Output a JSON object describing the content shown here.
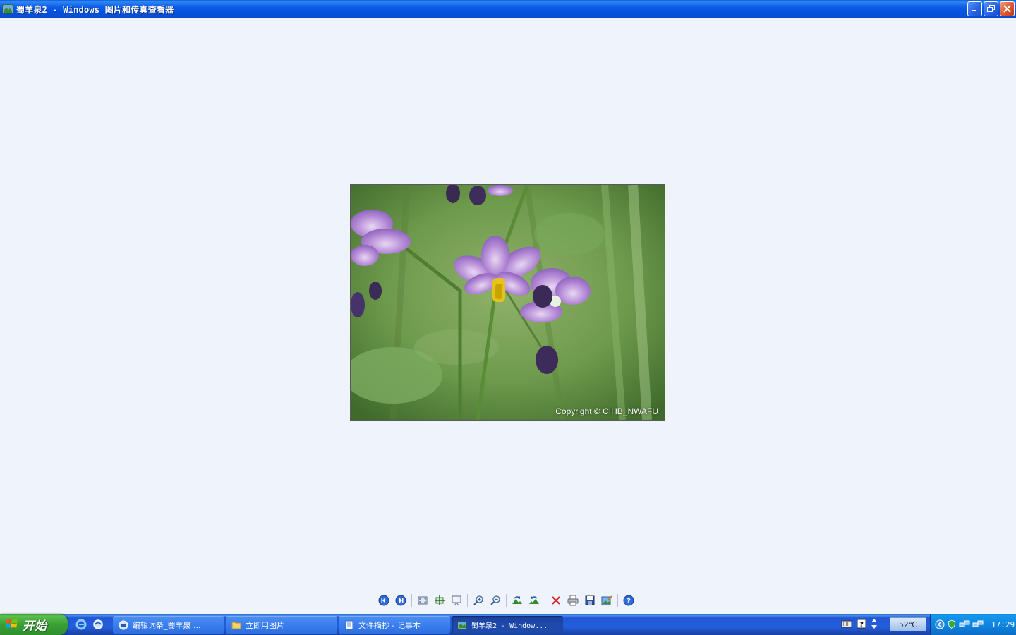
{
  "window": {
    "title": "蜀羊泉2 - Windows 图片和传真查看器",
    "controls": [
      "minimize",
      "restore",
      "close"
    ]
  },
  "image": {
    "description_icon": "photo",
    "watermark": "Copyright © CIHB_NWAFU"
  },
  "toolbar": {
    "buttons": [
      {
        "name": "previous-image-button",
        "icon": "previous-icon"
      },
      {
        "name": "next-image-button",
        "icon": "next-icon"
      },
      {
        "name": "best-fit-button",
        "icon": "best-fit-icon"
      },
      {
        "name": "actual-size-button",
        "icon": "actual-size-icon"
      },
      {
        "name": "slideshow-button",
        "icon": "slideshow-icon"
      },
      {
        "name": "zoom-in-button",
        "icon": "zoom-in-icon"
      },
      {
        "name": "zoom-out-button",
        "icon": "zoom-out-icon"
      },
      {
        "name": "rotate-clockwise-button",
        "icon": "rotate-clockwise-icon"
      },
      {
        "name": "rotate-counterclockwise-button",
        "icon": "rotate-counterclockwise-icon"
      },
      {
        "name": "delete-button",
        "icon": "delete-icon"
      },
      {
        "name": "print-button",
        "icon": "print-icon"
      },
      {
        "name": "save-button",
        "icon": "save-icon"
      },
      {
        "name": "edit-button",
        "icon": "edit-icon"
      },
      {
        "name": "help-button",
        "icon": "help-icon"
      }
    ]
  },
  "taskbar": {
    "start_label": "开始",
    "tasks": [
      {
        "label": "编辑词条_蜀羊泉 ...",
        "icon": "browser-page-icon"
      },
      {
        "label": "立即用图片",
        "icon": "folder-icon"
      },
      {
        "label": "文件摘抄 - 记事本",
        "icon": "notepad-icon"
      },
      {
        "label": "蜀羊泉2 - Window...",
        "icon": "image-viewer-icon",
        "active": true
      }
    ],
    "temperature": "52℃",
    "clock": "17:29"
  },
  "colors": {
    "titlebar": "#0b5ce6",
    "viewer_background": "#eef3fc",
    "taskbar": "#245edb",
    "start_button": "#38a034",
    "tray": "#0f82de"
  }
}
